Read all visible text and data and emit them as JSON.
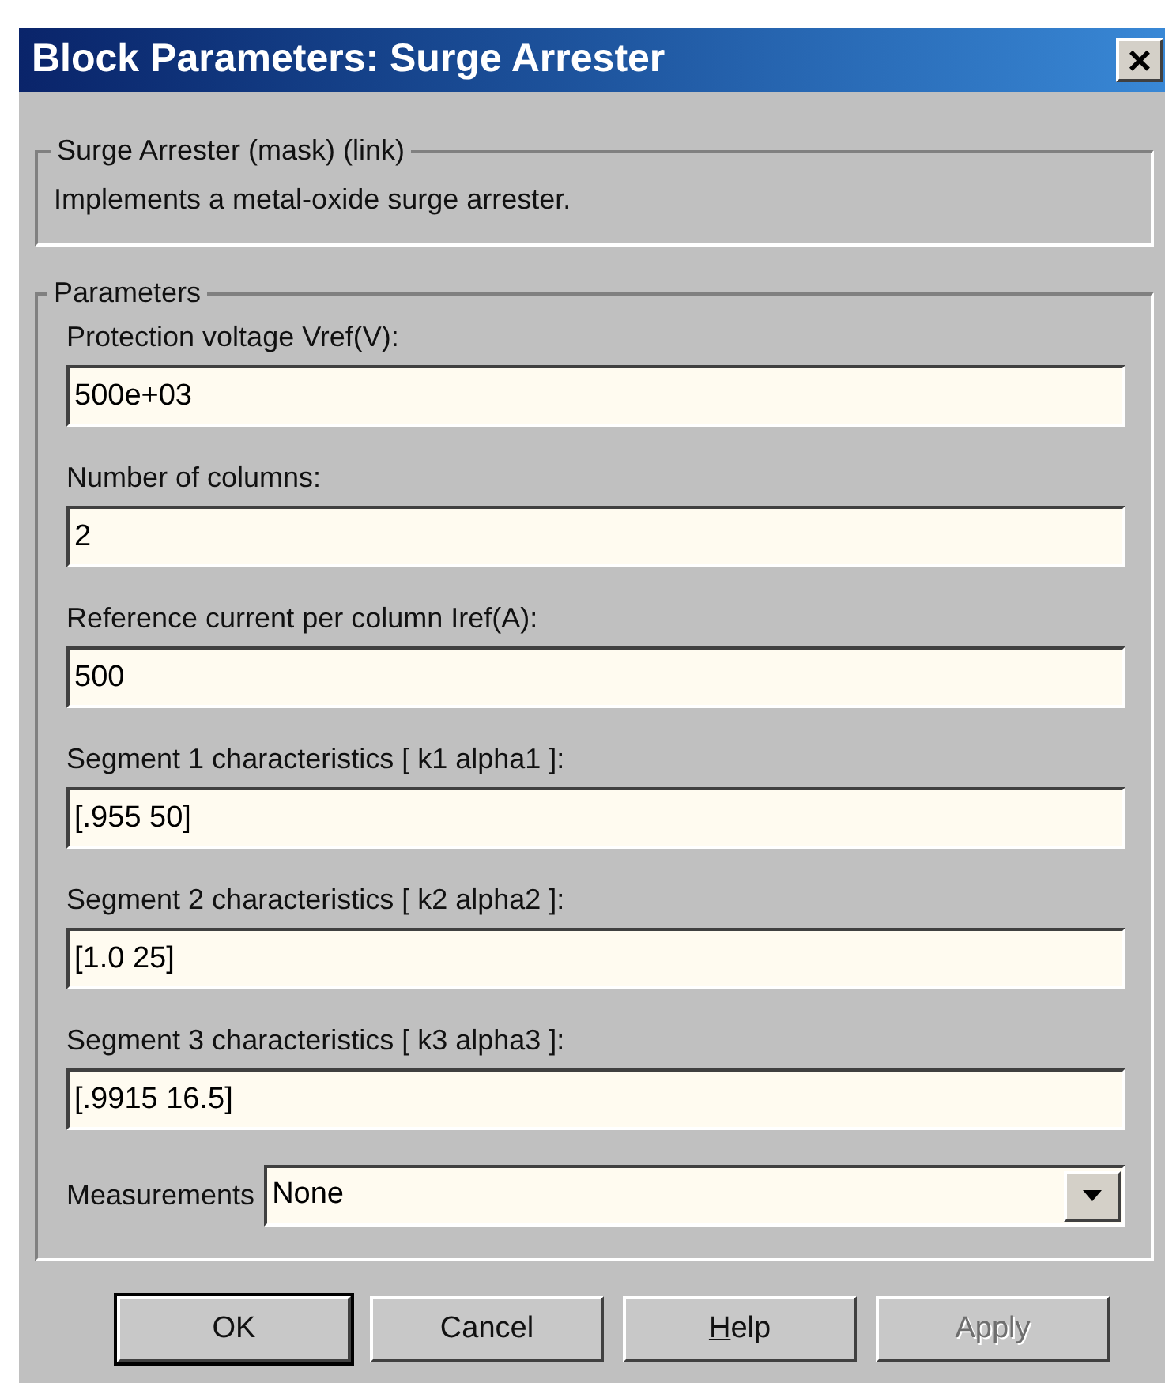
{
  "window": {
    "title": "Block Parameters: Surge Arrester",
    "close": "×"
  },
  "description_group": {
    "title": "Surge Arrester (mask) (link)",
    "text": "Implements a metal-oxide surge arrester."
  },
  "parameters_group": {
    "title": "Parameters",
    "fields": [
      {
        "label": "Protection voltage  Vref(V):",
        "value": "500e+03"
      },
      {
        "label": "Number of columns:",
        "value": "2"
      },
      {
        "label": "Reference current per column Iref(A):",
        "value": "500"
      },
      {
        "label": "Segment 1 characteristics [ k1 alpha1 ]:",
        "value": "[.955 50]"
      },
      {
        "label": "Segment 2 characteristics [ k2 alpha2 ]:",
        "value": "[1.0 25]"
      },
      {
        "label": "Segment 3 characteristics [ k3 alpha3 ]:",
        "value": "[.9915 16.5]"
      }
    ],
    "measurements": {
      "label": "Measurements",
      "value": "None"
    }
  },
  "buttons": [
    {
      "label": "OK",
      "default": true,
      "disabled": false,
      "first_letter_underlined": false
    },
    {
      "label": "Cancel",
      "default": false,
      "disabled": false,
      "first_letter_underlined": false
    },
    {
      "label": "Help",
      "default": false,
      "disabled": false,
      "first_letter_underlined": true
    },
    {
      "label": "Apply",
      "default": false,
      "disabled": true,
      "first_letter_underlined": false
    }
  ]
}
